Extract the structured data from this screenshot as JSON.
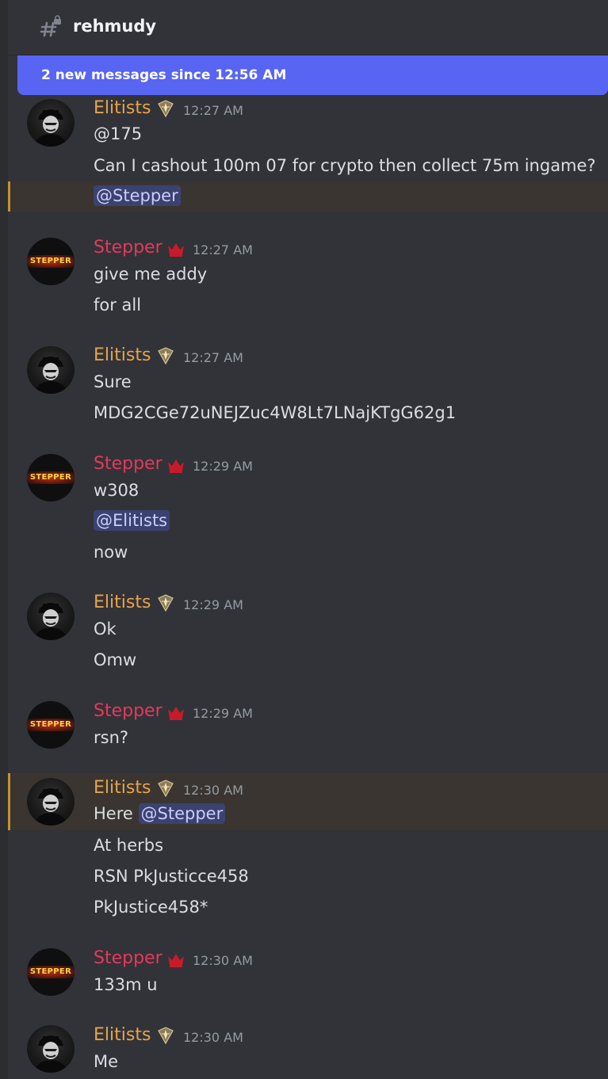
{
  "channel": {
    "name": "rehmudy"
  },
  "banner": {
    "text": "2 new messages since 12:56 AM"
  },
  "users": {
    "elitists": {
      "name": "Elitists",
      "avatar_text": ""
    },
    "stepper": {
      "name": "Stepper",
      "avatar_text": "STEPPER"
    }
  },
  "messages": [
    {
      "author": "Elitists",
      "time": "12:27 AM",
      "lines": [
        "@175",
        "Can I cashout 100m 07 for crypto then collect 75m ingame?",
        "@Stepper"
      ]
    },
    {
      "author": "Stepper",
      "time": "12:27 AM",
      "lines": [
        "give me addy",
        "for all"
      ]
    },
    {
      "author": "Elitists",
      "time": "12:27 AM",
      "lines": [
        "Sure",
        "MDG2CGe72uNEJZuc4W8Lt7LNajKTgG62g1"
      ]
    },
    {
      "author": "Stepper",
      "time": "12:29 AM",
      "lines": [
        "w308",
        "@Elitists",
        "now"
      ]
    },
    {
      "author": "Elitists",
      "time": "12:29 AM",
      "lines": [
        "Ok",
        "Omw"
      ]
    },
    {
      "author": "Stepper",
      "time": "12:29 AM",
      "lines": [
        "rsn?"
      ]
    },
    {
      "author": "Elitists",
      "time": "12:30 AM",
      "lines": [
        "Here",
        "@Stepper",
        "At herbs",
        "RSN PkJusticce458",
        "PkJustice458*"
      ]
    },
    {
      "author": "Stepper",
      "time": "12:30 AM",
      "lines": [
        "133m u"
      ]
    },
    {
      "author": "Elitists",
      "time": "12:30 AM",
      "lines": [
        "Me"
      ]
    }
  ],
  "colors": {
    "background": "#313338",
    "banner": "#5865f2",
    "elitists": "#e8a34a",
    "stepper": "#e5395a",
    "mention_bg": "#3c4270",
    "mention_fg": "#c9cdfb"
  },
  "icons": {
    "channel": "hashtag-lock-icon",
    "elitists_badge": "diamond-badge-icon",
    "stepper_badge": "crown-icon"
  }
}
